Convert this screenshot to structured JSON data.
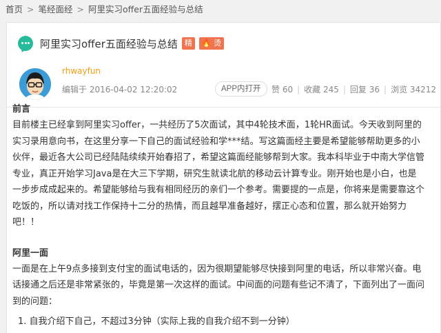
{
  "breadcrumb": {
    "items": [
      "首页",
      "笔经面经",
      "阿里实习offer五面经验与总结"
    ],
    "separator": ">"
  },
  "post": {
    "title": "阿里实习offer五面经验与总结",
    "badge_jing": "精",
    "badge_hot": "烫",
    "author": "rhwayfun",
    "edited": "编辑于 2016-04-02 12:20:02",
    "app_open": "APP内打开",
    "likes": "赞 60",
    "favorites": "收藏 245",
    "replies": "回复 36",
    "views": "浏览 34212"
  },
  "content": {
    "section1_title": "前言",
    "section1_text": "目前楼主已经拿到阿里实习offer，一共经历了5次面试，其中4轮技术面，1轮HR面试。今天收到阿里的实习录用意向书，在这里分享一下自己的面试经验和学***结。写这篇面经主要是希望能够帮助更多的小伙伴，最近各大公司已经陆陆续续开始春招了，希望这篇面经能够帮到大家。我本科毕业于中南大学信管专业，真正开始学习Java是在大三下学期，研究生就读北航的移动云计算专业。刚开始也是小白，也是一步步成成起来的。希望能够给与我有相同经历的亲们一个参考。需要提的一点是，你将来是需要靠这个吃饭的，所以请对找工作保持十二分的热情，而且越早准备越好，摆正心态和位置，那么就开始努力吧！！",
    "section2_title": "阿里一面",
    "section2_text": "一面是在上午9点多接到支付宝的面试电话的，因为很期望能够尽快接到阿里的电话，所以非常兴奋。电话接通之后还是非常紧张的，毕竟是第一次这样的面试。中间面的问题有些记不清了，下面列出了一面问到的问题：",
    "list_item_1": "1. 自我介绍下自己，不超过3分钟（实际上我的自我介绍不到一分钟）"
  },
  "colors": {
    "accent_green": "#25bb9b",
    "badge_orange": "#f0744e",
    "author_orange": "#f39c12"
  }
}
